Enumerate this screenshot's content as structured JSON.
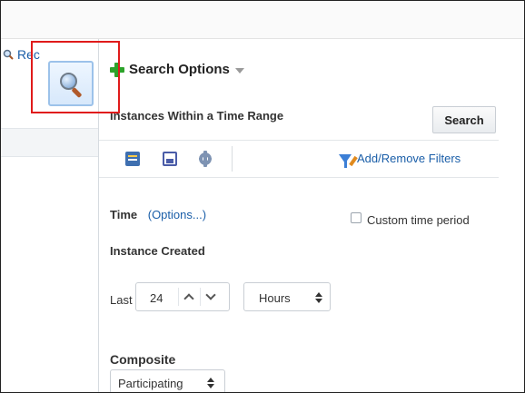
{
  "left_panel": {
    "recent_link_label": "Rec"
  },
  "search_panel": {
    "title": "Search Options",
    "range_label": "Instances Within a Time Range",
    "search_button": "Search",
    "toolbar": {
      "icons": [
        "saved-query-icon",
        "save-icon",
        "settings-gear-icon"
      ],
      "filters_link": "Add/Remove Filters"
    },
    "time": {
      "label": "Time",
      "options_link": "(Options...)",
      "custom_label": "Custom time period",
      "custom_checked": false
    },
    "instance_created": {
      "label": "Instance Created",
      "last_label": "Last",
      "amount": "24",
      "unit": "Hours"
    },
    "composite": {
      "label": "Composite",
      "value": "Participating"
    }
  },
  "colors": {
    "highlight_border": "#e01b1b",
    "link": "#1a5ea8",
    "plus_green": "#2ea22a"
  }
}
